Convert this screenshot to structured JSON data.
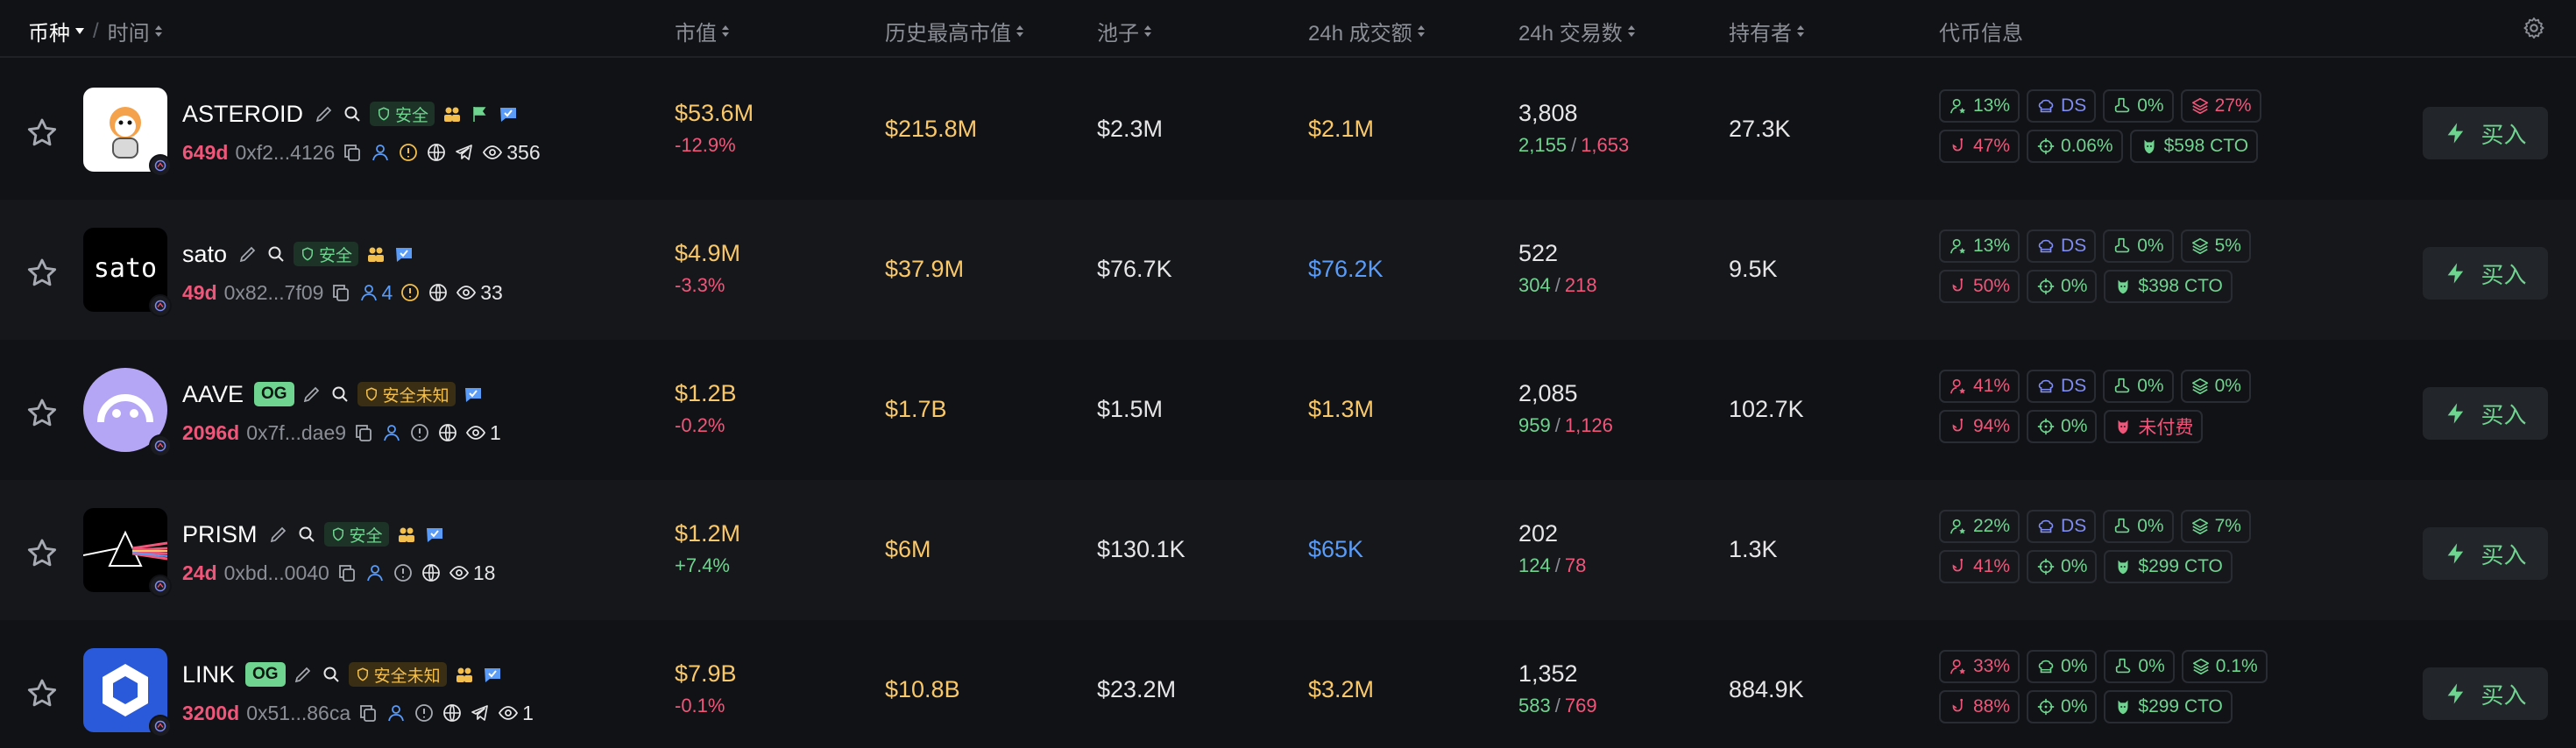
{
  "header": {
    "token_col": "币种",
    "time_col": "时间",
    "market_cap": "市值",
    "ath_market_cap": "历史最高市值",
    "pool": "池子",
    "volume_24h": "24h 成交额",
    "txns_24h": "24h 交易数",
    "holders": "持有者",
    "token_info": "代币信息"
  },
  "colors": {
    "accent_green": "#6fd48f",
    "accent_red": "#f0567a",
    "gold": "#f9c86a",
    "blue": "#5a9cf8",
    "background": "#111215"
  },
  "rows": [
    {
      "name": "ASTEROID",
      "badge": "安全",
      "badge_type": "safe",
      "og": "",
      "age": "649d",
      "address": "0xf2...4126",
      "holder_count": "",
      "views": "356",
      "market_cap": "$53.6M",
      "change": "-12.9%",
      "change_dir": "neg",
      "ath": "$215.8M",
      "pool": "$2.3M",
      "volume": "$2.1M",
      "volume_color": "gold",
      "txns": "3,808",
      "buys": "2,155",
      "sells": "1,653",
      "holders": "27.3K",
      "info": {
        "top10": "13%",
        "dev": "DS",
        "insiders": "0%",
        "bundled": "27%",
        "snipers": "47%",
        "dex_fee": "0.06%",
        "paid": "$598 CTO",
        "paid_type": "g",
        "top10_type": "g",
        "snipers_type": "r",
        "bundled_type": "r",
        "dev_type": "b"
      }
    },
    {
      "name": "sato",
      "badge": "安全",
      "badge_type": "safe",
      "og": "",
      "age": "49d",
      "address": "0x82...7f09",
      "holder_count": "4",
      "views": "33",
      "market_cap": "$4.9M",
      "change": "-3.3%",
      "change_dir": "neg",
      "ath": "$37.9M",
      "pool": "$76.7K",
      "volume": "$76.2K",
      "volume_color": "blue",
      "txns": "522",
      "buys": "304",
      "sells": "218",
      "holders": "9.5K",
      "info": {
        "top10": "13%",
        "dev": "DS",
        "insiders": "0%",
        "bundled": "5%",
        "snipers": "50%",
        "dex_fee": "0%",
        "paid": "$398 CTO",
        "paid_type": "g",
        "top10_type": "g",
        "snipers_type": "r",
        "bundled_type": "g",
        "dev_type": "b"
      }
    },
    {
      "name": "AAVE",
      "badge": "安全未知",
      "badge_type": "unknown",
      "og": "OG",
      "age": "2096d",
      "address": "0x7f...dae9",
      "holder_count": "",
      "views": "1",
      "market_cap": "$1.2B",
      "change": "-0.2%",
      "change_dir": "neg",
      "ath": "$1.7B",
      "pool": "$1.5M",
      "volume": "$1.3M",
      "volume_color": "gold",
      "txns": "2,085",
      "buys": "959",
      "sells": "1,126",
      "holders": "102.7K",
      "info": {
        "top10": "41%",
        "dev": "DS",
        "insiders": "0%",
        "bundled": "0%",
        "snipers": "94%",
        "dex_fee": "0%",
        "paid": "未付费",
        "paid_type": "r",
        "top10_type": "r",
        "snipers_type": "r",
        "bundled_type": "g",
        "dev_type": "b"
      }
    },
    {
      "name": "PRISM",
      "badge": "安全",
      "badge_type": "safe",
      "og": "",
      "age": "24d",
      "address": "0xbd...0040",
      "holder_count": "",
      "views": "18",
      "market_cap": "$1.2M",
      "change": "+7.4%",
      "change_dir": "pos",
      "ath": "$6M",
      "pool": "$130.1K",
      "volume": "$65K",
      "volume_color": "blue",
      "txns": "202",
      "buys": "124",
      "sells": "78",
      "holders": "1.3K",
      "info": {
        "top10": "22%",
        "dev": "DS",
        "insiders": "0%",
        "bundled": "7%",
        "snipers": "41%",
        "dex_fee": "0%",
        "paid": "$299 CTO",
        "paid_type": "g",
        "top10_type": "g",
        "snipers_type": "r",
        "bundled_type": "g",
        "dev_type": "b"
      }
    },
    {
      "name": "LINK",
      "badge": "安全未知",
      "badge_type": "unknown",
      "og": "OG",
      "age": "3200d",
      "address": "0x51...86ca",
      "holder_count": "",
      "views": "1",
      "market_cap": "$7.9B",
      "change": "-0.1%",
      "change_dir": "neg",
      "ath": "$10.8B",
      "pool": "$23.2M",
      "volume": "$3.2M",
      "volume_color": "gold",
      "txns": "1,352",
      "buys": "583",
      "sells": "769",
      "holders": "884.9K",
      "info": {
        "top10": "33%",
        "dev": "0%",
        "insiders": "0%",
        "bundled": "0.1%",
        "snipers": "88%",
        "dex_fee": "0%",
        "paid": "$299 CTO",
        "paid_type": "g",
        "top10_type": "r",
        "snipers_type": "r",
        "bundled_type": "g",
        "dev_type": "g"
      }
    }
  ],
  "buy_label": "买入"
}
